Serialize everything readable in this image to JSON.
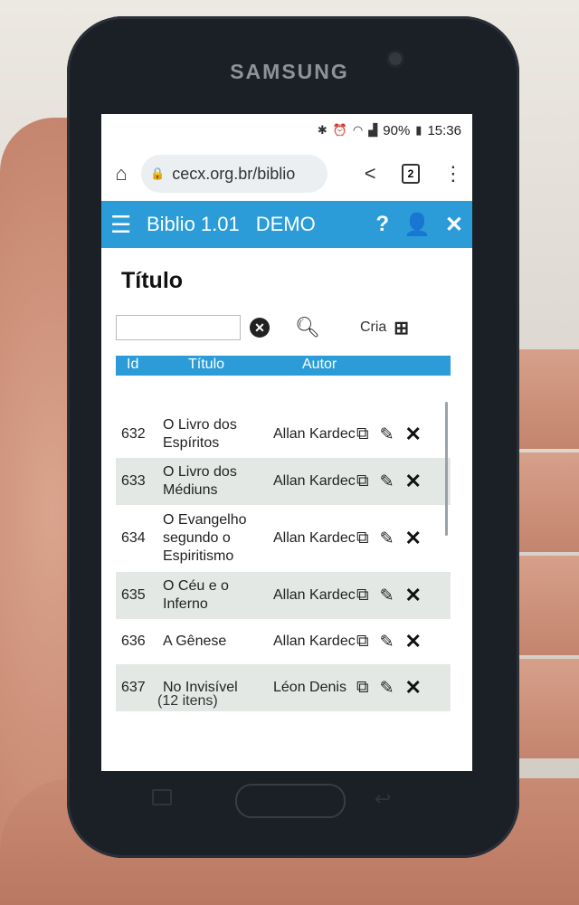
{
  "device": {
    "brand": "SAMSUNG"
  },
  "status_bar": {
    "battery": "90%",
    "time": "15:36"
  },
  "browser": {
    "url": "cecx.org.br/biblio",
    "tab_count": "2"
  },
  "appbar": {
    "title": "Biblio 1.01",
    "mode": "DEMO",
    "help": "?",
    "close": "✕"
  },
  "page": {
    "title": "Título",
    "search_value": "",
    "create_label": "Cria",
    "columns": {
      "id": "Id",
      "title": "Título",
      "author": "Autor"
    },
    "rows": [
      {
        "id": "632",
        "title": "O Livro dos Espíritos",
        "author": "Allan Kardec"
      },
      {
        "id": "633",
        "title": "O Livro dos Médiuns",
        "author": "Allan Kardec"
      },
      {
        "id": "634",
        "title": "O Evangelho segundo o Espiritismo",
        "author": "Allan Kardec"
      },
      {
        "id": "635",
        "title": "O Céu e o Inferno",
        "author": "Allan Kardec"
      },
      {
        "id": "636",
        "title": "A Gênese",
        "author": "Allan Kardec"
      },
      {
        "id": "637",
        "title": "No Invisível",
        "author": "Léon Denis"
      }
    ],
    "item_count": "(12 itens)"
  }
}
